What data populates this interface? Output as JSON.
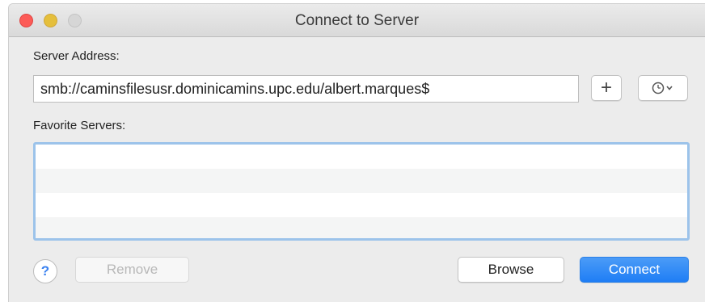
{
  "window": {
    "title": "Connect to Server"
  },
  "server_address": {
    "label": "Server Address:",
    "value": "smb://caminsfilesusr.dominicamins.upc.edu/albert.marques$"
  },
  "add_button": {
    "label": "+",
    "icon": "plus-icon"
  },
  "history_button": {
    "icon": "clock-icon",
    "chevron": "chevron-down-icon"
  },
  "favorites": {
    "label": "Favorite Servers:",
    "items": []
  },
  "buttons": {
    "help_label": "?",
    "remove_label": "Remove",
    "browse_label": "Browse",
    "connect_label": "Connect"
  },
  "colors": {
    "close": "#fc5b57",
    "minimize": "#e5bf3c",
    "zoom": "#d6d6d6",
    "accent": "#1f7ef5",
    "focus_ring": "#9cc3ea"
  }
}
